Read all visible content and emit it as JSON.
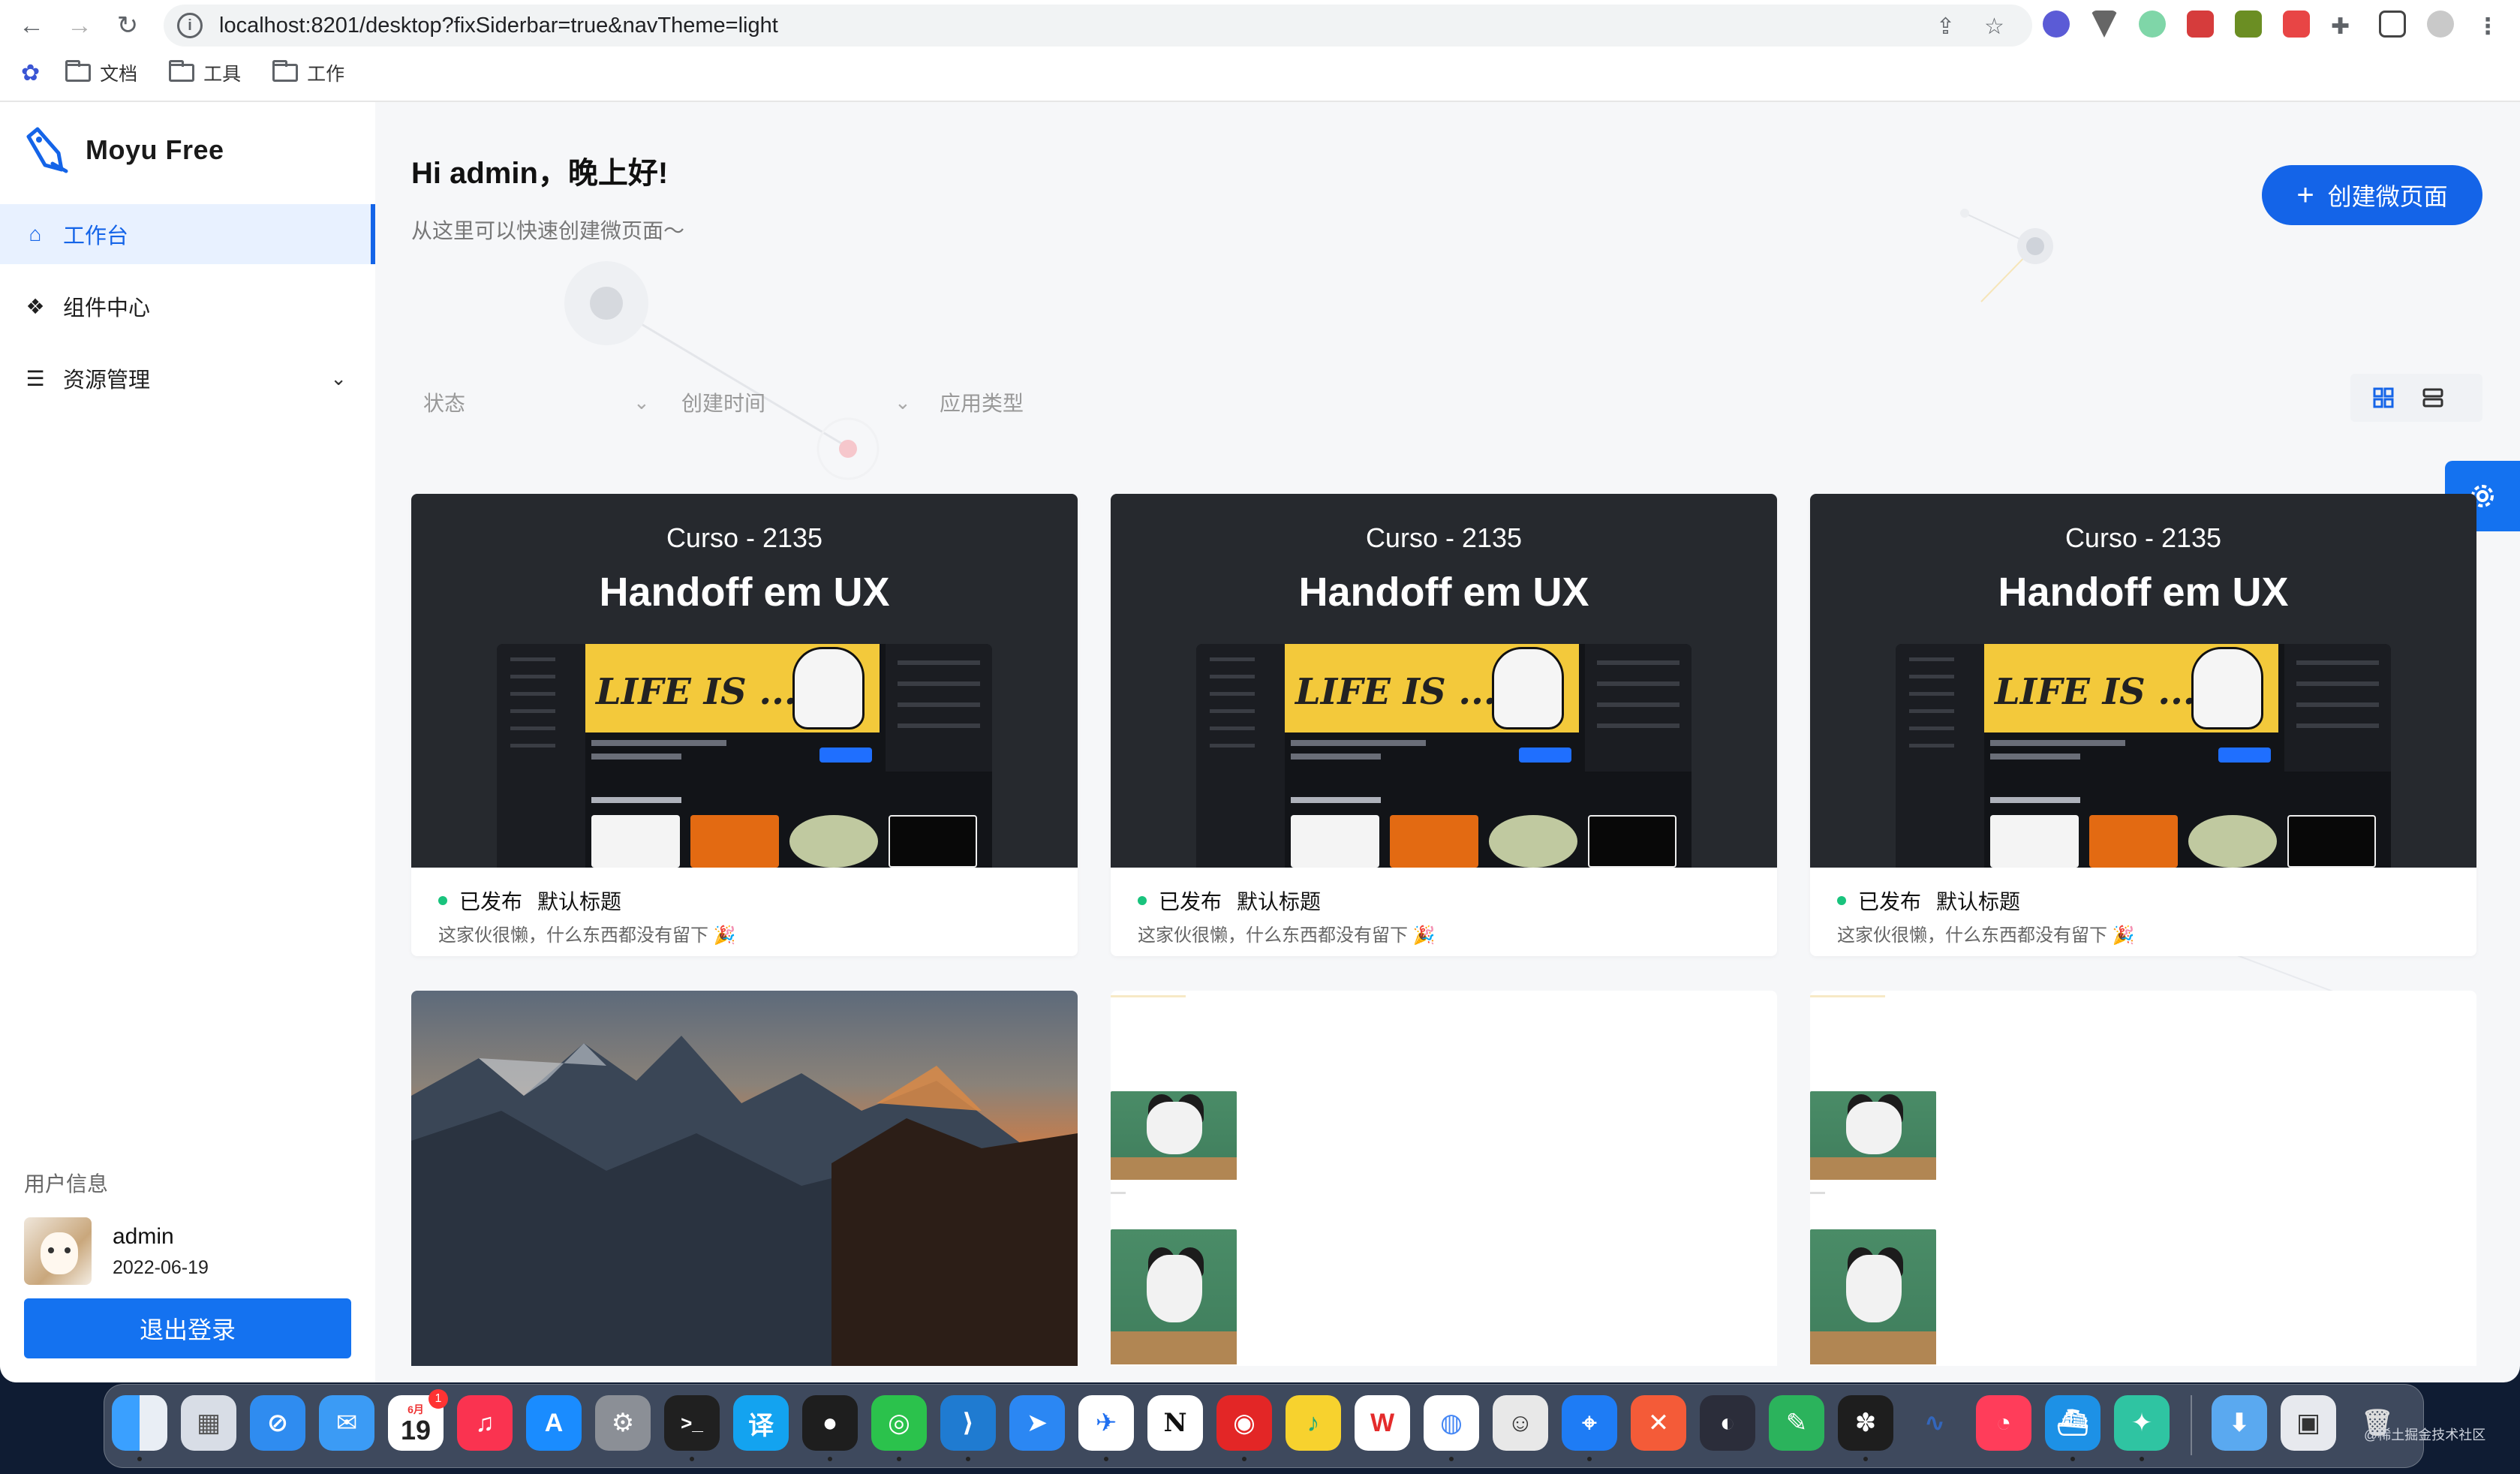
{
  "browser": {
    "url": "localhost:8201/desktop?fixSiderbar=true&navTheme=light",
    "bookmarks": [
      "文档",
      "工具",
      "工作"
    ]
  },
  "brand": {
    "name": "Moyu Free"
  },
  "sidebar": {
    "items": [
      {
        "label": "工作台",
        "icon": "home-icon",
        "active": true
      },
      {
        "label": "组件中心",
        "icon": "components-icon"
      },
      {
        "label": "资源管理",
        "icon": "database-icon",
        "expandable": true
      }
    ]
  },
  "user": {
    "section_label": "用户信息",
    "name": "admin",
    "date": "2022-06-19",
    "logout_label": "退出登录"
  },
  "main": {
    "greeting": "Hi admin，晚上好!",
    "subtitle": "从这里可以快速创建微页面～",
    "create_button": "创建微页面",
    "filters": {
      "status": "状态",
      "created": "创建时间",
      "type": "应用类型"
    },
    "view_modes": [
      "grid-view",
      "list-view"
    ]
  },
  "cards": [
    {
      "cover_subtitle": "Curso - 2135",
      "cover_title": "Handoff em UX",
      "status": "已发布",
      "title": "默认标题",
      "desc": "这家伙很懒，什么东西都没有留下 🎉"
    },
    {
      "cover_subtitle": "Curso - 2135",
      "cover_title": "Handoff em UX",
      "status": "已发布",
      "title": "默认标题",
      "desc": "这家伙很懒，什么东西都没有留下 🎉"
    },
    {
      "cover_subtitle": "Curso - 2135",
      "cover_title": "Handoff em UX",
      "status": "已发布",
      "title": "默认标题",
      "desc": "这家伙很懒，什么东西都没有留下 🎉"
    }
  ],
  "cover_mockup": {
    "banner_text": "LIFE IS ..."
  },
  "dock": {
    "calendar_month": "6月",
    "calendar_day": "19",
    "calendar_badge": "1",
    "watermark": "@稀土掘金技术社区"
  },
  "colors": {
    "primary": "#1464e8",
    "published": "#19c37d",
    "cover_bg": "#26292e"
  }
}
